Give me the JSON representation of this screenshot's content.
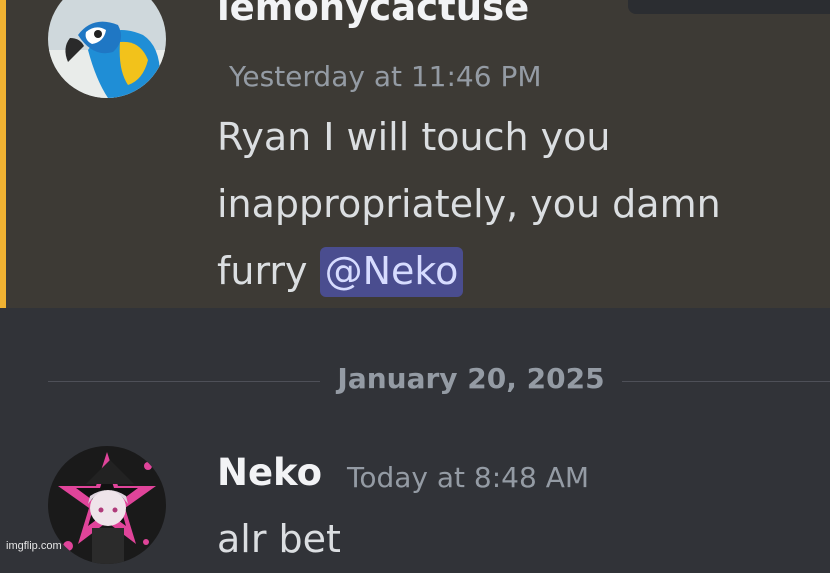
{
  "messages": [
    {
      "username": "lemonycactuse",
      "timestamp": "Yesterday at 11:46 PM",
      "lines": [
        "Ryan I will touch you",
        "inappropriately, you damn",
        "furry "
      ],
      "mention": "@Neko",
      "avatar_icon": "parrot-avatar-icon",
      "highlighted": true
    },
    {
      "username": "Neko",
      "timestamp": "Today at 8:48 AM",
      "lines": [
        "alr bet"
      ],
      "avatar_icon": "anime-girl-avatar-icon"
    }
  ],
  "date_divider": "January 20, 2025",
  "watermark": "imgflip.com",
  "colors": {
    "background": "#313338",
    "highlight_background": "#3d3a35",
    "mention_bar": "#f0b232",
    "mention_background": "#4a4d8f"
  }
}
